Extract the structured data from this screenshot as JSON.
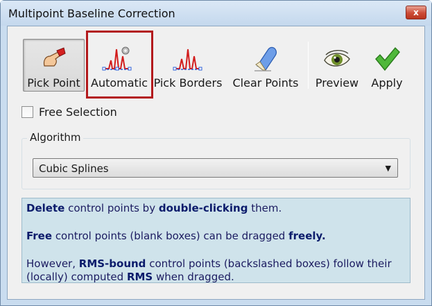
{
  "window": {
    "title": "Multipoint Baseline Correction",
    "close_label": "x"
  },
  "toolbar": {
    "items": [
      {
        "label": "Pick Point",
        "icon": "hand-pick-icon",
        "pressed": true
      },
      {
        "label": "Automatic",
        "icon": "auto-baseline-icon",
        "pressed": false
      },
      {
        "label": "Pick Borders",
        "icon": "borders-baseline-icon",
        "pressed": false
      },
      {
        "label": "Clear Points",
        "icon": "eraser-icon",
        "pressed": false
      },
      {
        "label": "Preview",
        "icon": "eye-icon",
        "pressed": false
      },
      {
        "label": "Apply",
        "icon": "checkmark-icon",
        "pressed": false
      }
    ]
  },
  "free_selection": {
    "label": "Free Selection",
    "checked": false
  },
  "algorithm": {
    "legend": "Algorithm",
    "selected": "Cubic Splines"
  },
  "info": {
    "line1_bold1": "Delete",
    "line1_text": "control points by",
    "line1_bold2": "double-clicking",
    "line1_end": "them.",
    "line2_bold1": "Free",
    "line2_text": "control points (blank boxes) can be dragged",
    "line2_bold2": "freely.",
    "line3_start": "However,",
    "line3_bold": "RMS-bound",
    "line3_text": "control points (backslashed boxes) follow their",
    "line4_start": "(locally) computed",
    "line4_bold": "RMS",
    "line4_end": "when dragged."
  },
  "colors": {
    "highlight": "#b3191c",
    "info_bg": "#cfe3eb",
    "window_frame": "#c9dcef"
  }
}
